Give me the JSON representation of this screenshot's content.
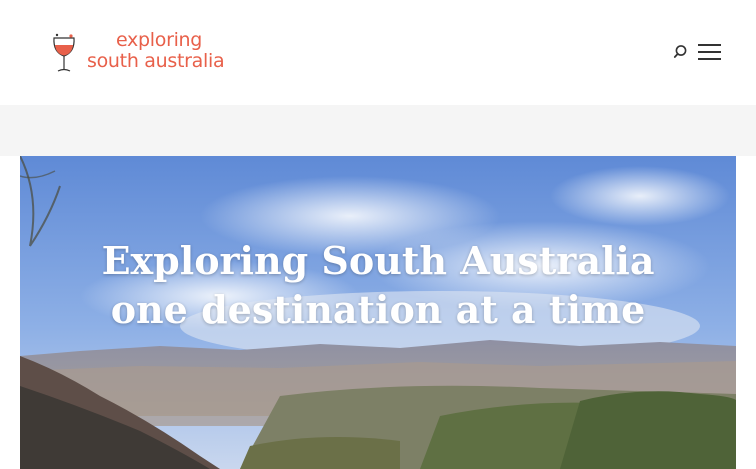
{
  "header": {
    "logo": {
      "line1": "exploring",
      "line2": "south australia",
      "colors": {
        "text": "#e8604a",
        "wine": "#e8604a"
      }
    },
    "search_icon": "search-icon",
    "menu_icon": "hamburger-menu-icon"
  },
  "hero": {
    "title_line1": "Exploring South Australia",
    "title_line2": "one destination at a time",
    "colors": {
      "sky": "#6f98dc",
      "ranges": "#9a9aa8",
      "foreground": "#4a5a3a"
    }
  }
}
